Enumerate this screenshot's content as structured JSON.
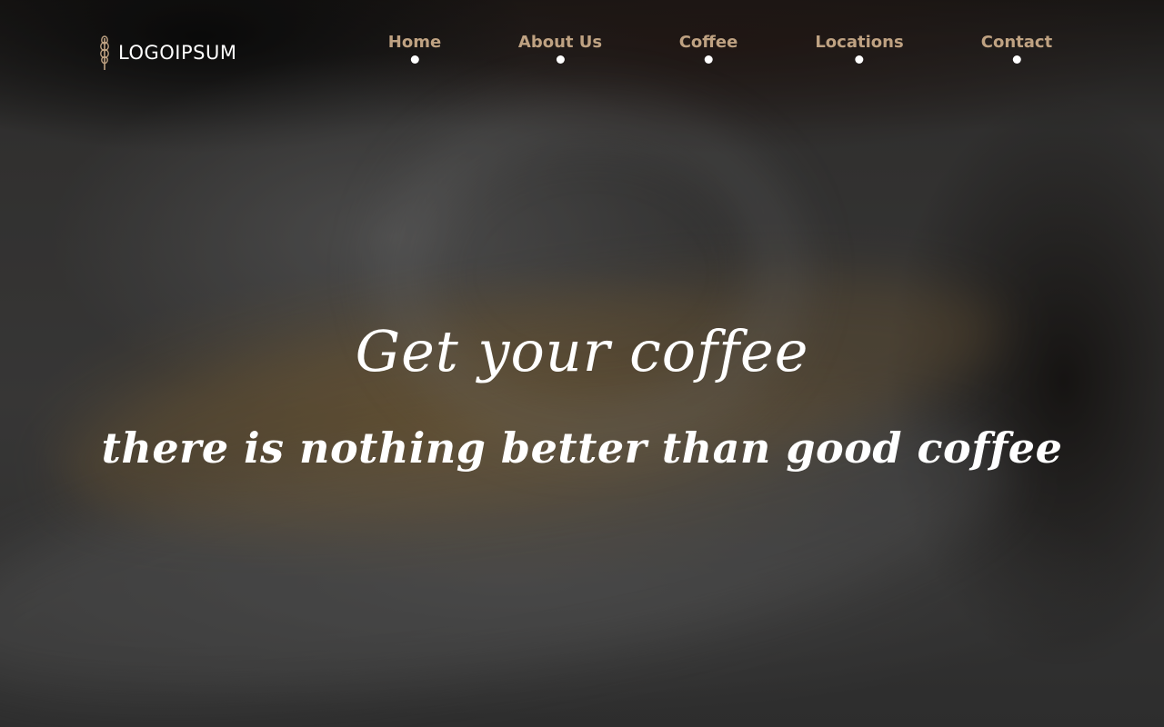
{
  "brand": {
    "logo_text": "LOGOIPSUM",
    "logo_icon": "wheat-icon"
  },
  "nav": {
    "items": [
      {
        "label": "Home"
      },
      {
        "label": "About Us"
      },
      {
        "label": "Coffee"
      },
      {
        "label": "Locations"
      },
      {
        "label": "Contact"
      }
    ]
  },
  "hero": {
    "title": "Get your coffee",
    "subtitle": "there is nothing better than good coffee"
  },
  "colors": {
    "nav_text": "#bfa282",
    "dot": "#ffffff",
    "hero_text": "#ffffff"
  }
}
